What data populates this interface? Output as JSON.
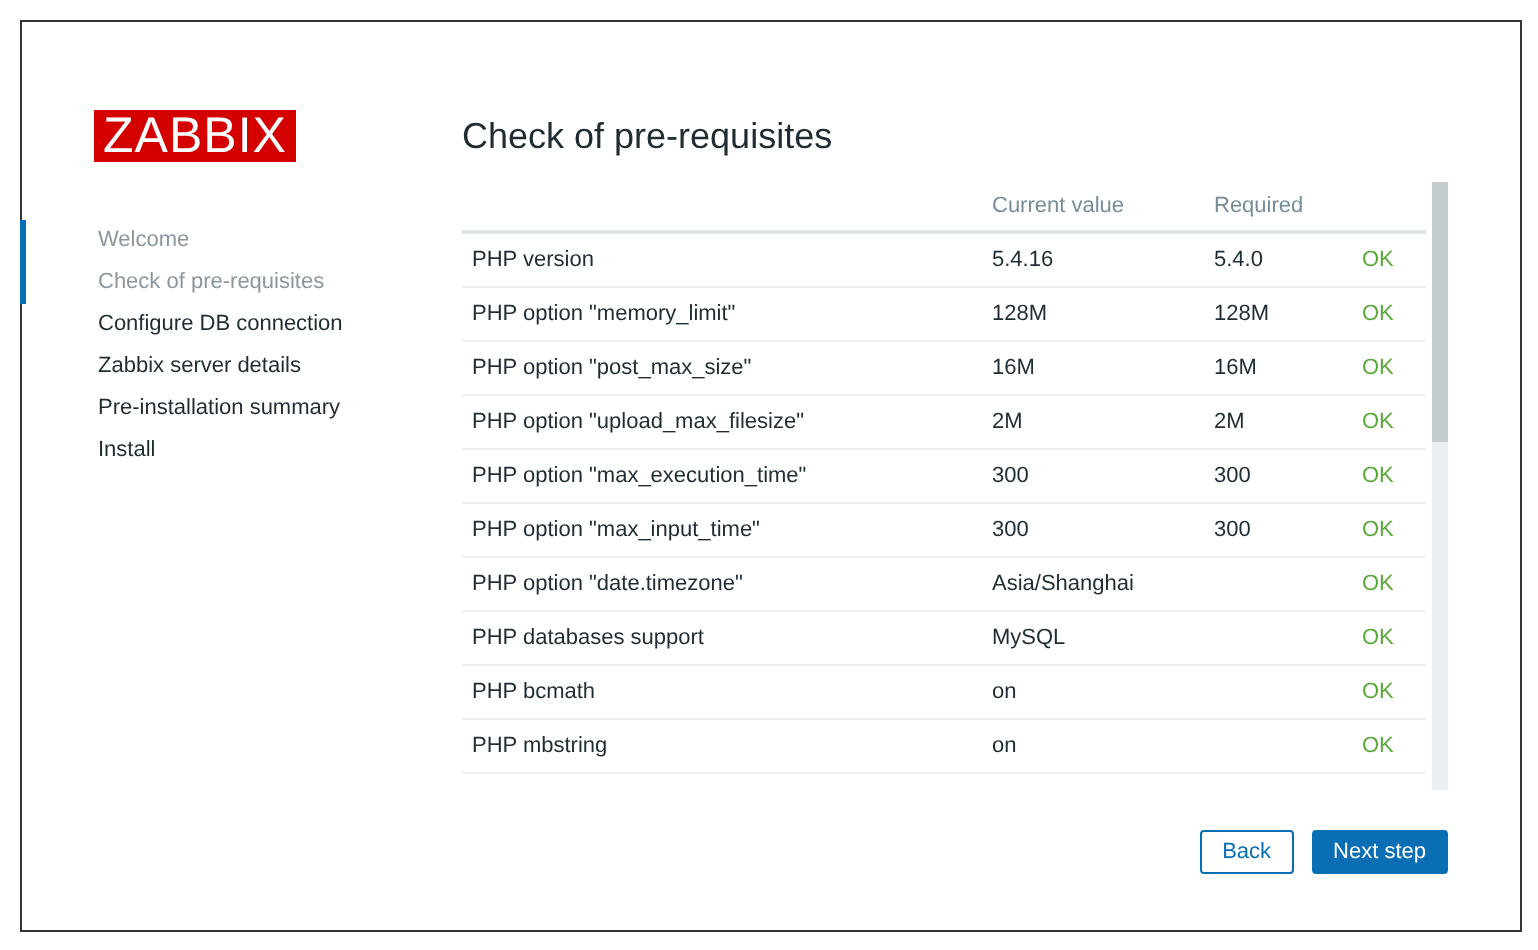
{
  "logo": {
    "text": "ZABBIX"
  },
  "steps": [
    {
      "label": "Welcome",
      "done": true
    },
    {
      "label": "Check of pre-requisites",
      "done": true
    },
    {
      "label": "Configure DB connection",
      "done": false
    },
    {
      "label": "Zabbix server details",
      "done": false
    },
    {
      "label": "Pre-installation summary",
      "done": false
    },
    {
      "label": "Install",
      "done": false
    }
  ],
  "title": "Check of pre-requisites",
  "table": {
    "columns": [
      "Current value",
      "Required"
    ],
    "rows": [
      {
        "name": "PHP version",
        "current": "5.4.16",
        "required": "5.4.0",
        "result": "OK"
      },
      {
        "name": "PHP option \"memory_limit\"",
        "current": "128M",
        "required": "128M",
        "result": "OK"
      },
      {
        "name": "PHP option \"post_max_size\"",
        "current": "16M",
        "required": "16M",
        "result": "OK"
      },
      {
        "name": "PHP option \"upload_max_filesize\"",
        "current": "2M",
        "required": "2M",
        "result": "OK"
      },
      {
        "name": "PHP option \"max_execution_time\"",
        "current": "300",
        "required": "300",
        "result": "OK"
      },
      {
        "name": "PHP option \"max_input_time\"",
        "current": "300",
        "required": "300",
        "result": "OK"
      },
      {
        "name": "PHP option \"date.timezone\"",
        "current": "Asia/Shanghai",
        "result": "OK"
      },
      {
        "name": "PHP databases support",
        "current": "MySQL",
        "result": "OK"
      },
      {
        "name": "PHP bcmath",
        "current": "on",
        "result": "OK"
      },
      {
        "name": "PHP mbstring",
        "current": "on",
        "result": "OK"
      }
    ]
  },
  "buttons": [
    {
      "label": "Back",
      "kind": "secondary"
    },
    {
      "label": "Next step",
      "kind": "primary"
    }
  ]
}
